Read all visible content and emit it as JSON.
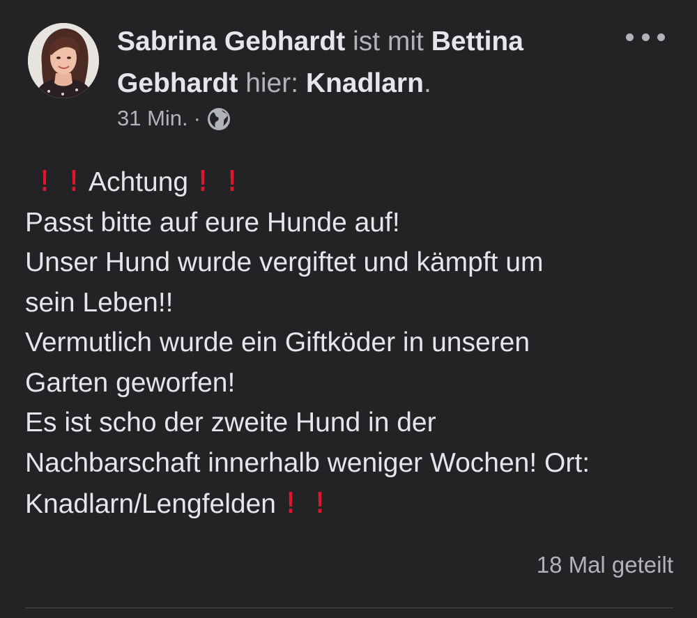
{
  "post": {
    "author": "Sabrina Gebhardt",
    "with_text": " ist mit ",
    "tagged_first": "Bettina",
    "tagged_last": "Gebhardt",
    "here_text": " hier: ",
    "place": "Knadlarn",
    "place_suffix": ".",
    "timestamp": "31 Min.",
    "separator": "·",
    "privacy_icon": "globe-icon",
    "menu_icon": "more-horizontal-icon",
    "lines": {
      "l1_text": "Achtung",
      "l2": "Passt bitte auf eure Hunde auf!",
      "l3": "Unser Hund wurde vergiftet und kämpft um",
      "l4": "sein Leben!!",
      "l5": "Vermutlich wurde ein Giftköder in unseren",
      "l6": "Garten geworfen!",
      "l7": "Es ist scho der zweite Hund in der",
      "l8": "Nachbarschaft innerhalb weniger Wochen! Ort:",
      "l9_text": "Knadlarn/Lengfelden"
    },
    "emoji_bang": "!",
    "emoji_name": "red-exclamation-icon",
    "shares": "18 Mal geteilt",
    "colors": {
      "background": "#232325",
      "text": "#e4e6eb",
      "secondary": "#b0b3b8",
      "emoji_red": "#e0162b"
    }
  }
}
